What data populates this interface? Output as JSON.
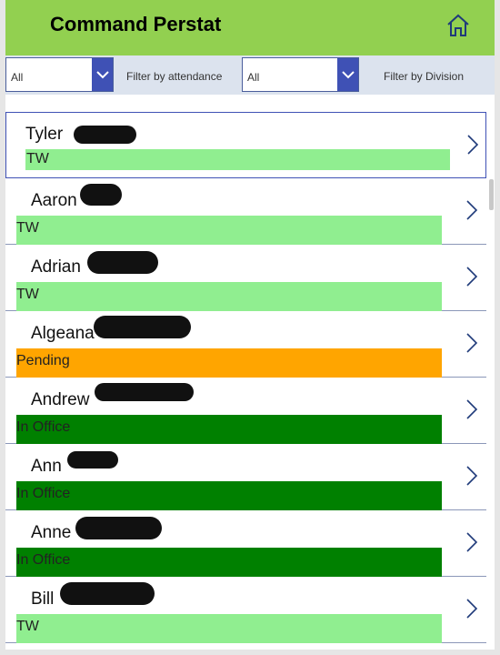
{
  "app": {
    "title": "Command Perstat",
    "home_icon": "home-icon"
  },
  "filters": {
    "attendance": {
      "value": "All",
      "label": "Filter by attendance"
    },
    "division": {
      "value": "All",
      "label": "Filter by Division"
    }
  },
  "colors": {
    "header": "#92d050",
    "tw": "#90ee90",
    "pending": "#ffa500",
    "in_office": "#008000",
    "accent": "#3f51b5"
  },
  "rows": [
    {
      "name": "Tyler",
      "status": "TW",
      "status_color": "#90ee90"
    },
    {
      "name": "Aaron",
      "status": "TW",
      "status_color": "#90ee90"
    },
    {
      "name": "Adrian",
      "status": "TW",
      "status_color": "#90ee90"
    },
    {
      "name": "Algeana",
      "status": "Pending",
      "status_color": "#ffa500"
    },
    {
      "name": "Andrew",
      "status": "In Office",
      "status_color": "#008000"
    },
    {
      "name": "Ann",
      "status": "In Office",
      "status_color": "#008000"
    },
    {
      "name": "Anne",
      "status": "In Office",
      "status_color": "#008000"
    },
    {
      "name": "Bill",
      "status": "TW",
      "status_color": "#90ee90"
    }
  ]
}
